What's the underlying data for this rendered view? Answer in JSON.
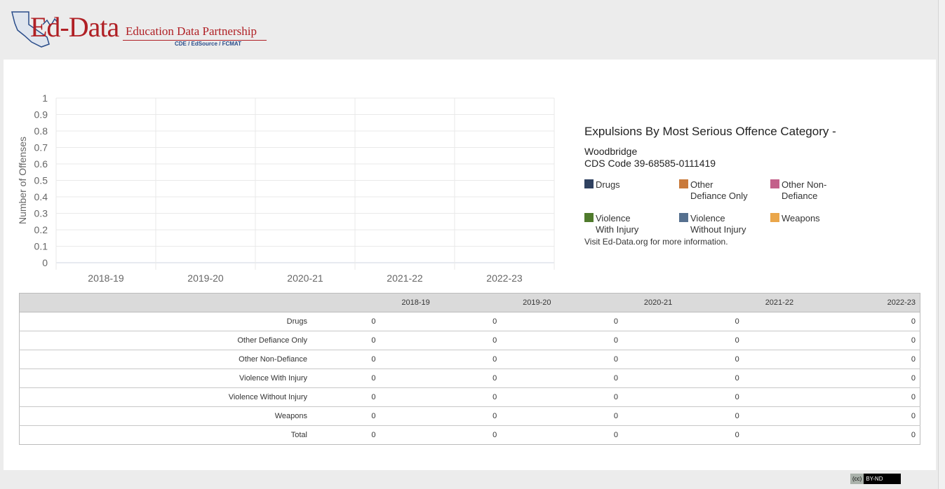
{
  "header": {
    "logo_text": "Ed-Data",
    "logo_tagline": "Education Data Partnership",
    "logo_subtitle": "CDE / EdSource / FCMAT",
    "brand_color": "#b02025"
  },
  "info": {
    "title": "Expulsions By Most Serious Offence Category -",
    "school": "Woodbridge",
    "cds_code": "CDS Code 39-68585-0111419",
    "visit_text": "Visit Ed-Data.org for more information."
  },
  "chart_data": {
    "type": "bar",
    "title": "",
    "xlabel": "",
    "ylabel": "Number of Offenses",
    "ylim": [
      0,
      1
    ],
    "y_ticks": [
      "0",
      "0.1",
      "0.2",
      "0.3",
      "0.4",
      "0.5",
      "0.6",
      "0.7",
      "0.8",
      "0.9",
      "1"
    ],
    "categories": [
      "2018-19",
      "2019-20",
      "2020-21",
      "2021-22",
      "2022-23"
    ],
    "series": [
      {
        "name": "Drugs",
        "color": "#2f4160",
        "values": [
          0,
          0,
          0,
          0,
          0
        ]
      },
      {
        "name": "Other Defiance Only",
        "color": "#c97a3b",
        "values": [
          0,
          0,
          0,
          0,
          0
        ]
      },
      {
        "name": "Other Non-Defiance",
        "color": "#c3608a",
        "values": [
          0,
          0,
          0,
          0,
          0
        ]
      },
      {
        "name": "Violence With Injury",
        "color": "#4f7a2c",
        "values": [
          0,
          0,
          0,
          0,
          0
        ]
      },
      {
        "name": "Violence Without Injury",
        "color": "#56708f",
        "values": [
          0,
          0,
          0,
          0,
          0
        ]
      },
      {
        "name": "Weapons",
        "color": "#eaa64a",
        "values": [
          0,
          0,
          0,
          0,
          0
        ]
      }
    ],
    "grid": true,
    "legend_position": "right"
  },
  "legend": [
    {
      "line1": "Drugs",
      "line2": "",
      "color": "#2f4160"
    },
    {
      "line1": "Other",
      "line2": "Defiance Only",
      "color": "#c97a3b"
    },
    {
      "line1": "Other Non-",
      "line2": "Defiance",
      "color": "#c3608a"
    },
    {
      "line1": "Violence",
      "line2": "With Injury",
      "color": "#4f7a2c"
    },
    {
      "line1": "Violence",
      "line2": "Without Injury",
      "color": "#56708f"
    },
    {
      "line1": "Weapons",
      "line2": "",
      "color": "#eaa64a"
    }
  ],
  "table": {
    "corner": "",
    "headers": [
      "2018-19",
      "2019-20",
      "2020-21",
      "2021-22",
      "2022-23"
    ],
    "rows": [
      {
        "label": "Drugs",
        "values": [
          "0",
          "0",
          "0",
          "0",
          "0"
        ]
      },
      {
        "label": "Other Defiance Only",
        "values": [
          "0",
          "0",
          "0",
          "0",
          "0"
        ]
      },
      {
        "label": "Other Non-Defiance",
        "values": [
          "0",
          "0",
          "0",
          "0",
          "0"
        ]
      },
      {
        "label": "Violence With Injury",
        "values": [
          "0",
          "0",
          "0",
          "0",
          "0"
        ]
      },
      {
        "label": "Violence Without Injury",
        "values": [
          "0",
          "0",
          "0",
          "0",
          "0"
        ]
      },
      {
        "label": "Weapons",
        "values": [
          "0",
          "0",
          "0",
          "0",
          "0"
        ]
      },
      {
        "label": "Total",
        "values": [
          "0",
          "0",
          "0",
          "0",
          "0"
        ]
      }
    ]
  },
  "footer": {
    "license_cc": "(cc)",
    "license_text": "BY-ND"
  }
}
